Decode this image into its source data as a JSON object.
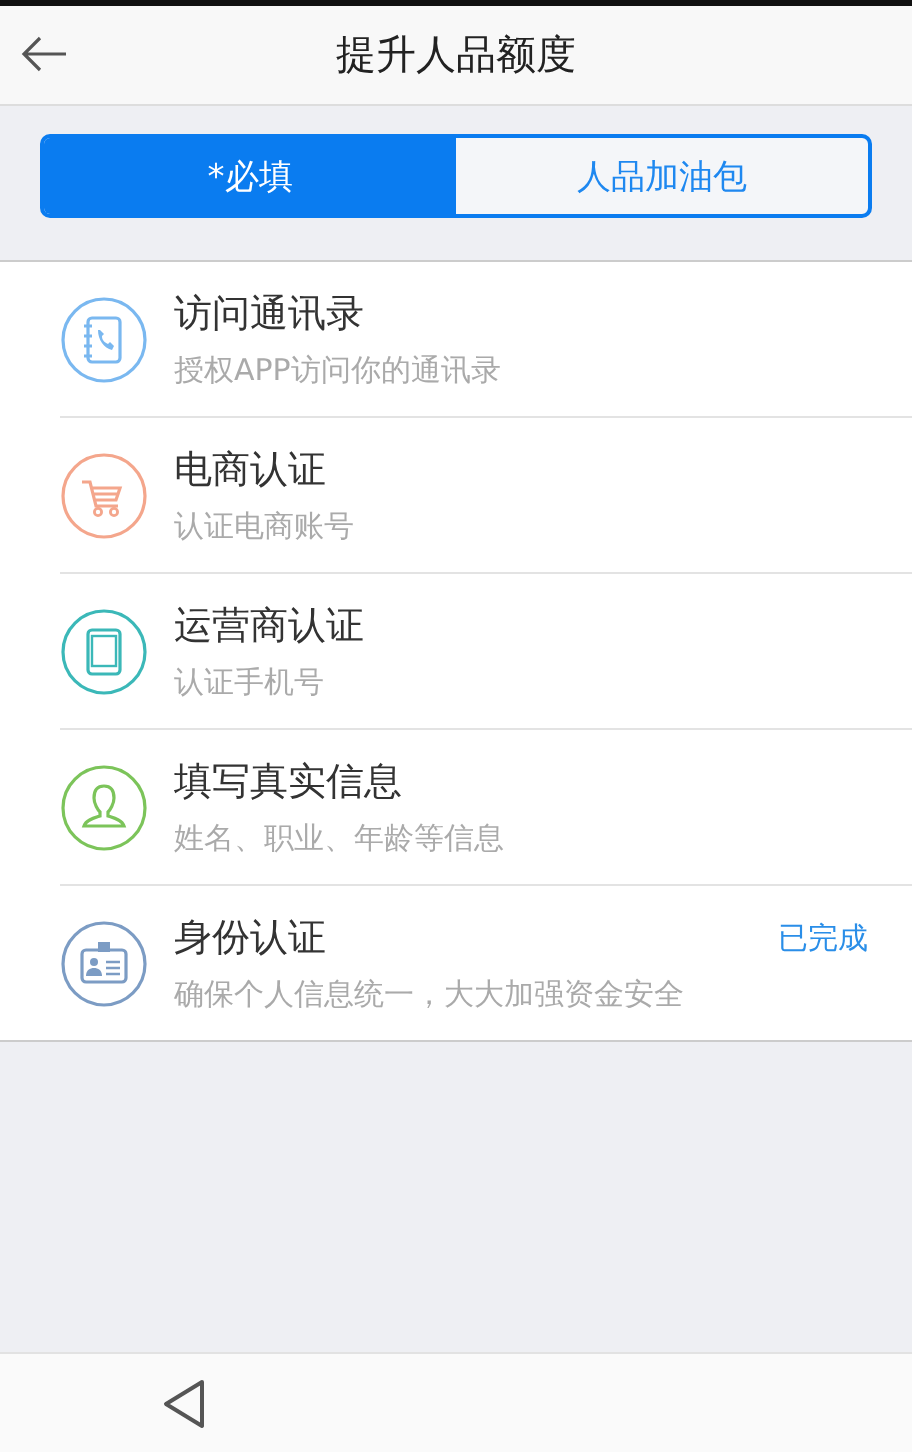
{
  "header": {
    "title": "提升人品额度"
  },
  "tabs": [
    {
      "label": "*必填",
      "selected": true
    },
    {
      "label": "人品加油包",
      "selected": false
    }
  ],
  "items": [
    {
      "kind": "contacts",
      "color": "#7ab8f0",
      "title": "访问通讯录",
      "subtitle": "授权APP访问你的通讯录"
    },
    {
      "kind": "cart",
      "color": "#f4a68c",
      "title": "电商认证",
      "subtitle": "认证电商账号"
    },
    {
      "kind": "tablet",
      "color": "#3bb8b8",
      "title": "运营商认证",
      "subtitle": "认证手机号"
    },
    {
      "kind": "person",
      "color": "#7cc45a",
      "title": "填写真实信息",
      "subtitle": "姓名、职业、年龄等信息"
    },
    {
      "kind": "idcard",
      "color": "#7c9cc4",
      "title": "身份认证",
      "subtitle": "确保个人信息统一，大大加强资金安全",
      "status": "已完成"
    }
  ]
}
